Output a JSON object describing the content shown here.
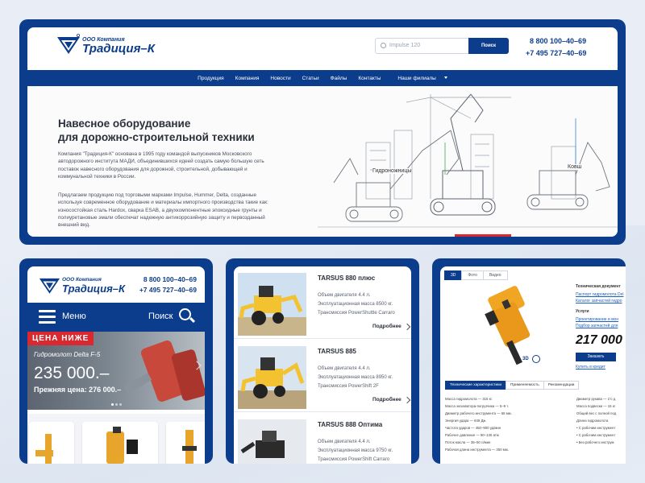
{
  "company": {
    "sub": "ООО Компания",
    "name": "Традиция–К"
  },
  "header": {
    "search_placeholder": "Impulse 120",
    "search_button": "Поиск",
    "phone1": "8 800 100–40–69",
    "phone2": "+7 495 727–40–69"
  },
  "nav": [
    "Продукция",
    "Компания",
    "Новости",
    "Статьи",
    "Файлы",
    "Контакты",
    "Наши филиалы"
  ],
  "hero": {
    "title1": "Навесное оборудование",
    "title2": "для дорожно-строительной техники",
    "p1": "Компания \"Традиция-К\" основана в 1995 году командой выпускников Московского автодорожного института МАДИ, объединившихся идеей создать самую большую сеть поставок навесного оборудования для дорожной, строительной, добывающей и коммунальной техники в России.",
    "p2": "Предлагаем продукцию под торговыми марками Impulse, Hummer, Delta, созданные используя современное оборудование и материалы импортного производства такие как: износостойкая сталь Hardox, сварка ESAB, а двухкомпонентные эпоксидные грунты и полиуретановые эмали обеспечат надежную антикоррозийную защиту и первозданный внешний вид.",
    "label1": "Гидроножницы",
    "label2": "Ковш"
  },
  "mobile1": {
    "phone1": "8 800 100–40–69",
    "phone2": "+7 495 727–40–69",
    "menu": "Меню",
    "search": "Поиск",
    "tag": "ЦЕНА НИЖЕ",
    "subtitle": "Гидромолот Delta F-5",
    "price": "235 000.–",
    "old_price": "Прежняя цена: 276 000.–"
  },
  "products": [
    {
      "title": "TARSUS 880 плюс",
      "l1": "Объем двигателя 4.4 л.",
      "l2": "Эксплуатационная масса 8500 кг.",
      "l3": "Трансмиссия PowerShuttle Carraro",
      "more": "Подробнее"
    },
    {
      "title": "TARSUS 885",
      "l1": "Объем двигателя 4.4 л.",
      "l2": "Эксплуатационная масса 8950 кг.",
      "l3": "Трансмиссия PowerShift 2F",
      "more": "Подробнее"
    },
    {
      "title": "TARSUS 888 Оптима",
      "l1": "Объем двигателя 4.4 л.",
      "l2": "Эксплуатационная масса 9750 кг.",
      "l3": "Трансмиссия PowerShift Carraro",
      "more": "Подробнее"
    }
  ],
  "mobile3": {
    "tabs": [
      "3D",
      "Фото",
      "Видео"
    ],
    "docs_title": "Техническая документ",
    "doc1": "Паспорт гидромолота Del",
    "doc2": "Каталог запчастей гидро",
    "services_title": "Услуги",
    "svc1": "Проектирование и мон",
    "svc2": "Подбор запчастей для",
    "price": "217 000",
    "order": "Заказать",
    "credit": "Купить в кредит",
    "viewer": "3D",
    "spec_tabs": [
      "Технические характеристики",
      "Применяемость",
      "Рекомендации"
    ],
    "specs": [
      "Масса гидромолота — 315 кг.",
      "Масса экскаватора-погрузчика — 5–9 т.",
      "Диаметр рабочего инструмента — 68 мм.",
      "Энергия удара — 849 Дж.",
      "Частота ударов — 450–900 уд/мин",
      "Рабочее давление — 90–130 атм",
      "Поток масла — 35–50 л/мин",
      "Рабочая длина инструмента — 350 мм."
    ],
    "specs2": [
      "Диаметр рукава — 1½ д",
      "Масса подвески — 15 кг",
      "Общий вес с полной под",
      "Длина гидромолота",
      "• С рабочим инструмент",
      "• С рабочим инструмент",
      "• Без рабочего инструм"
    ]
  },
  "colors": {
    "brand": "#0c3d8c",
    "sale": "#d9282f",
    "accent_green": "#3aa84b",
    "accent_blue": "#3d7fd9"
  }
}
